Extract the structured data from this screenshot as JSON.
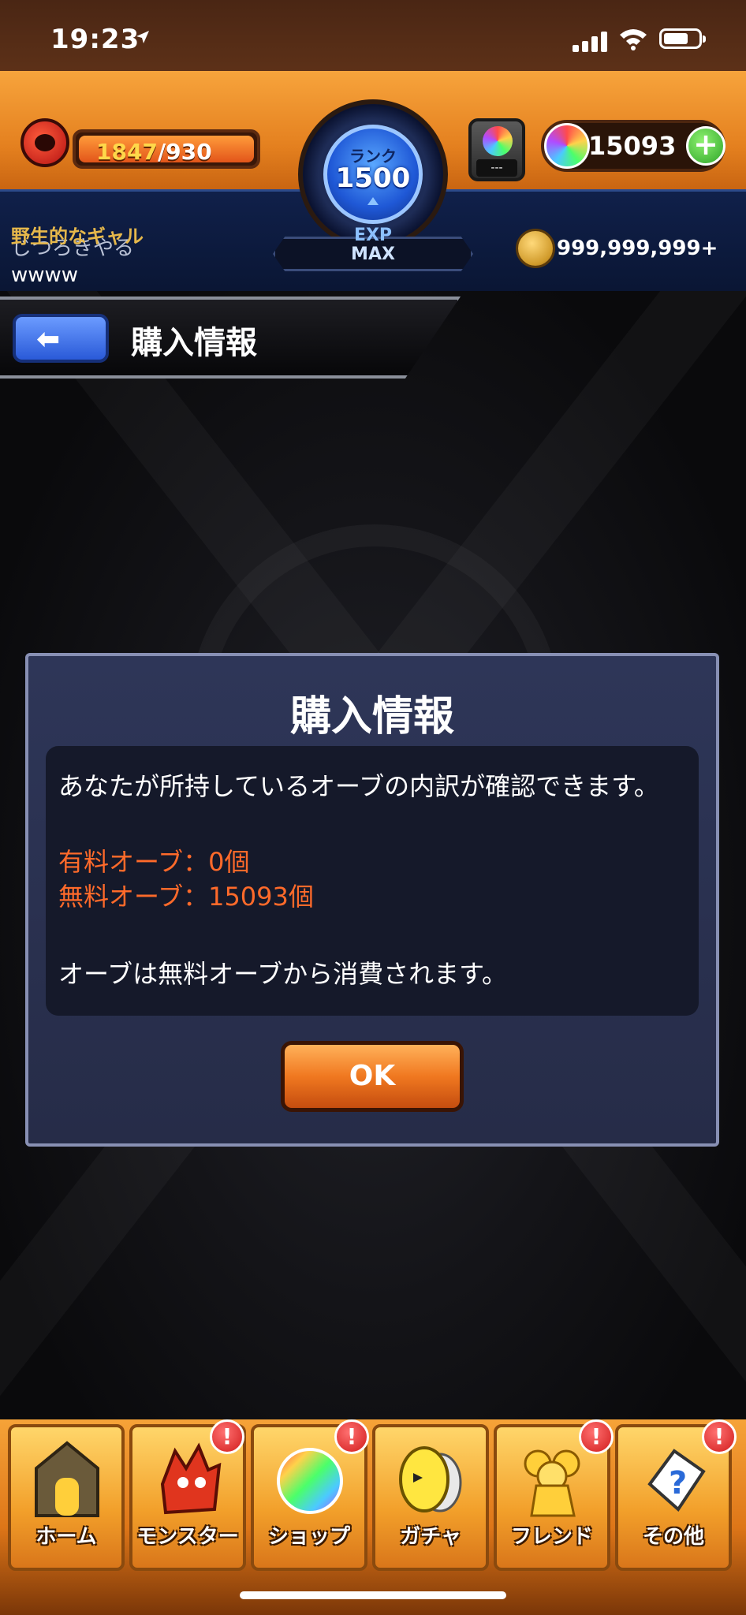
{
  "status_bar": {
    "time": "19:23"
  },
  "hud": {
    "stamina_current": "1847",
    "stamina_max": "/930",
    "rank_label": "ランク",
    "rank_value": "1500",
    "exp_label": "EXP",
    "exp_value": "MAX",
    "item_slot": "---",
    "orb_count": "15093",
    "add_label": "+",
    "player_title": "野生的なギャル",
    "player_name": "じつろきやる",
    "player_comment": "wwww",
    "coin_count": "999,999,999+"
  },
  "header": {
    "back_label": "⬅",
    "title": "購入情報"
  },
  "dialog": {
    "title": "購入情報",
    "description": "あなたが所持しているオーブの内訳が確認できます。",
    "paid_orbs": "有料オーブ：0個",
    "free_orbs": "無料オーブ：15093個",
    "note": "オーブは無料オーブから消費されます。",
    "ok_label": "OK"
  },
  "tabs": [
    {
      "label": "ホーム",
      "icon": "home-icon",
      "badge": ""
    },
    {
      "label": "モンスター",
      "icon": "monster-icon",
      "badge": "!"
    },
    {
      "label": "ショップ",
      "icon": "orb-icon",
      "badge": "!"
    },
    {
      "label": "ガチャ",
      "icon": "egg-icon",
      "badge": ""
    },
    {
      "label": "フレンド",
      "icon": "friends-icon",
      "badge": "!"
    },
    {
      "label": "その他",
      "icon": "question-icon",
      "badge": "!"
    }
  ],
  "colors": {
    "accent_orange": "#ff6a2a",
    "dialog_bg": "#2e3658",
    "hud_orange": "#f7a43c"
  }
}
